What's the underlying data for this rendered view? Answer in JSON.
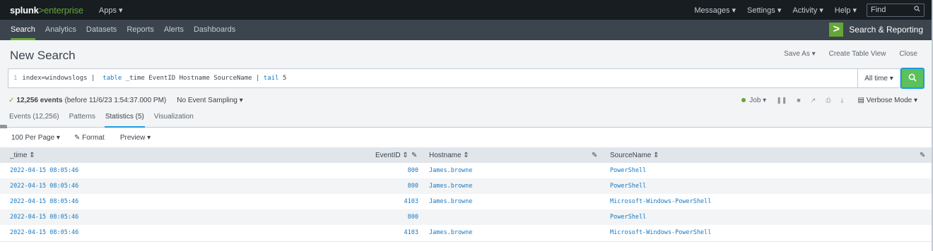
{
  "topbar": {
    "brand_prefix": "splunk",
    "brand_gt": ">",
    "brand_suffix": "enterprise",
    "apps_menu": "Apps ▾",
    "menu": [
      "Messages ▾",
      "Settings ▾",
      "Activity ▾",
      "Help ▾"
    ],
    "find_placeholder": "Find"
  },
  "appbar": {
    "nav": [
      "Search",
      "Analytics",
      "Datasets",
      "Reports",
      "Alerts",
      "Dashboards"
    ],
    "active_nav": "Search",
    "app_title": "Search & Reporting"
  },
  "page": {
    "title": "New Search",
    "actions": [
      "Save As ▾",
      "Create Table View",
      "Close"
    ]
  },
  "search": {
    "line_number": "1",
    "query_part1": "index=windowslogs |  ",
    "query_cmd1": "table",
    "query_part2": " _time EventID Hostname SourceName | ",
    "query_cmd2": "tail",
    "query_part3": " 5",
    "time_range": "All time ▾"
  },
  "status": {
    "check": "✓",
    "event_count": "12,256 events",
    "event_detail": "(before 11/6/23 1:54:37.000 PM)",
    "sampling": "No Event Sampling ▾",
    "job": "Job ▾",
    "verbose_mode": "Verbose Mode ▾"
  },
  "tabs": [
    "Events (12,256)",
    "Patterns",
    "Statistics (5)",
    "Visualization"
  ],
  "active_tab": "Statistics (5)",
  "toolbar": {
    "per_page": "100 Per Page ▾",
    "format": "Format",
    "preview": "Preview ▾"
  },
  "table": {
    "headers": {
      "time": "_time ⇕",
      "eventid": "EventID ⇕",
      "hostname": "Hostname ⇕",
      "sourcename": "SourceName ⇕"
    },
    "rows": [
      {
        "time": "2022-04-15 08:05:46",
        "eventid": "800",
        "hostname": "James.browne",
        "sourcename": "PowerShell"
      },
      {
        "time": "2022-04-15 08:05:46",
        "eventid": "800",
        "hostname": "James.browne",
        "sourcename": "PowerShell"
      },
      {
        "time": "2022-04-15 08:05:46",
        "eventid": "4103",
        "hostname": "James.browne",
        "sourcename": "Microsoft-Windows-PowerShell"
      },
      {
        "time": "2022-04-15 08:05:46",
        "eventid": "800",
        "hostname": "",
        "sourcename": "PowerShell"
      },
      {
        "time": "2022-04-15 08:05:46",
        "eventid": "4103",
        "hostname": "James.browne",
        "sourcename": "Microsoft-Windows-PowerShell"
      }
    ]
  },
  "colors": {
    "accent_green": "#65a637",
    "link_blue": "#1a78c2",
    "active_tab_blue": "#1a9cde",
    "topbar": "#171d21",
    "appbar": "#3c444d"
  }
}
